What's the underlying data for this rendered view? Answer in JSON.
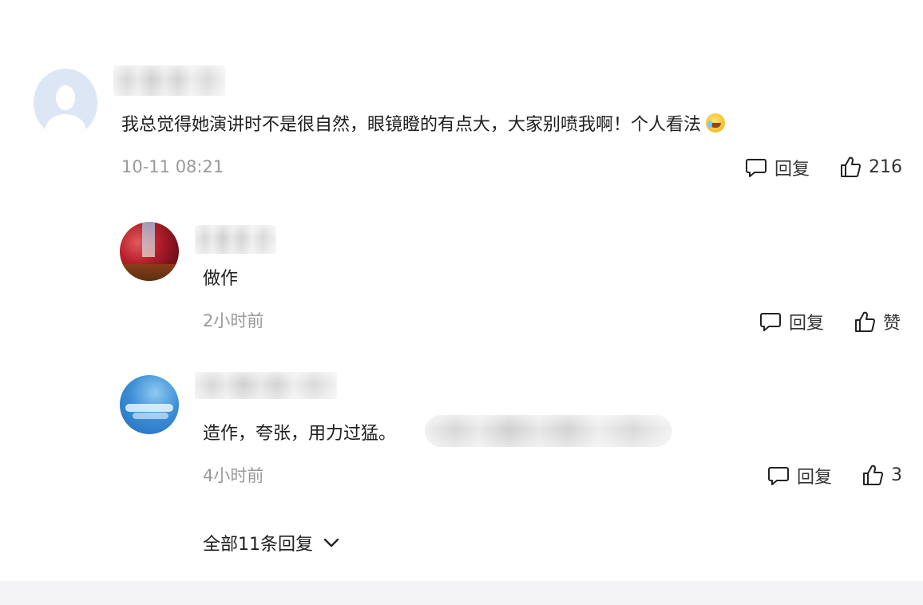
{
  "comments": [
    {
      "text": "我总觉得她演讲时不是很自然，眼镜瞪的有点大，大家别喷我啊！个人看法",
      "time": "10-11 08:21",
      "reply_label": "回复",
      "like_label": "216",
      "emoji_icon": "crying-laughing-emoji"
    },
    {
      "text": "做作",
      "time": "2小时前",
      "reply_label": "回复",
      "like_label": "赞"
    },
    {
      "text": "造作，夸张，用力过猛。",
      "time": "4小时前",
      "reply_label": "回复",
      "like_label": "3"
    }
  ],
  "more_replies_label": "全部11条回复",
  "icons": {
    "reply": "comment-bubble-icon",
    "like": "thumbs-up-icon",
    "expand": "chevron-down-icon"
  }
}
